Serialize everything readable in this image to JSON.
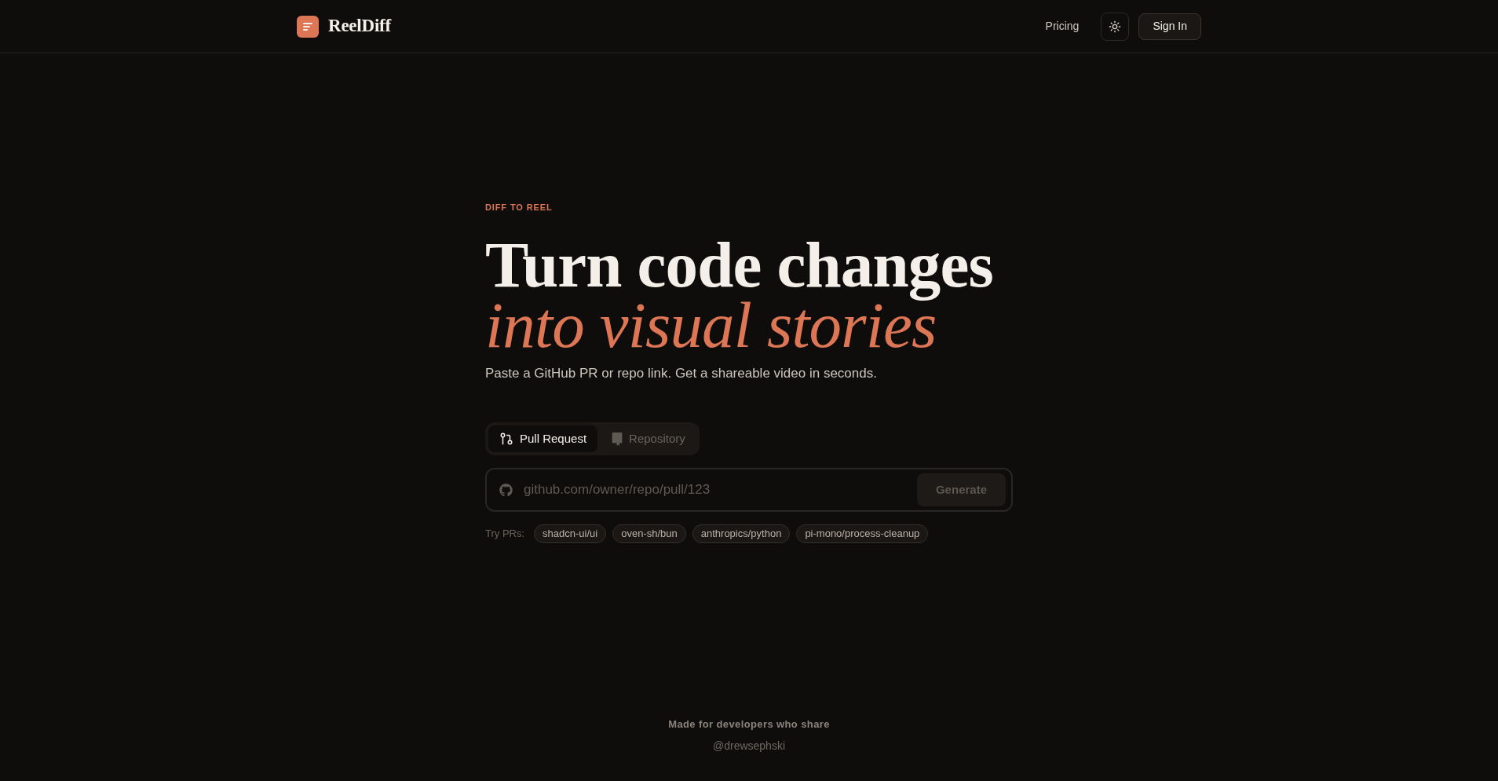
{
  "header": {
    "brand": "ReelDiff",
    "nav": [
      {
        "label": "Pricing"
      }
    ],
    "sign_in": "Sign In"
  },
  "hero": {
    "eyebrow": "DIFF TO REEL",
    "title_line_1": "Turn code changes",
    "title_line_2": "into visual stories",
    "subtitle": "Paste a GitHub PR or repo link. Get a shareable video in seconds."
  },
  "mode_tabs": [
    {
      "kind": "pull_request",
      "label": "Pull Request",
      "selected": true
    },
    {
      "kind": "repository",
      "label": "Repository",
      "selected": false
    }
  ],
  "url_input": {
    "placeholder": "github.com/owner/repo/pull/123"
  },
  "generate_button": {
    "label": "Generate",
    "disabled": true
  },
  "examples": {
    "label": "Try PRs:",
    "chips": [
      "shadcn-ui/ui",
      "oven-sh/bun",
      "anthropics/python",
      "pi-mono/process-cleanup"
    ]
  },
  "footer": {
    "tagline": "Made for developers who share",
    "handle": "@drewsephski"
  }
}
